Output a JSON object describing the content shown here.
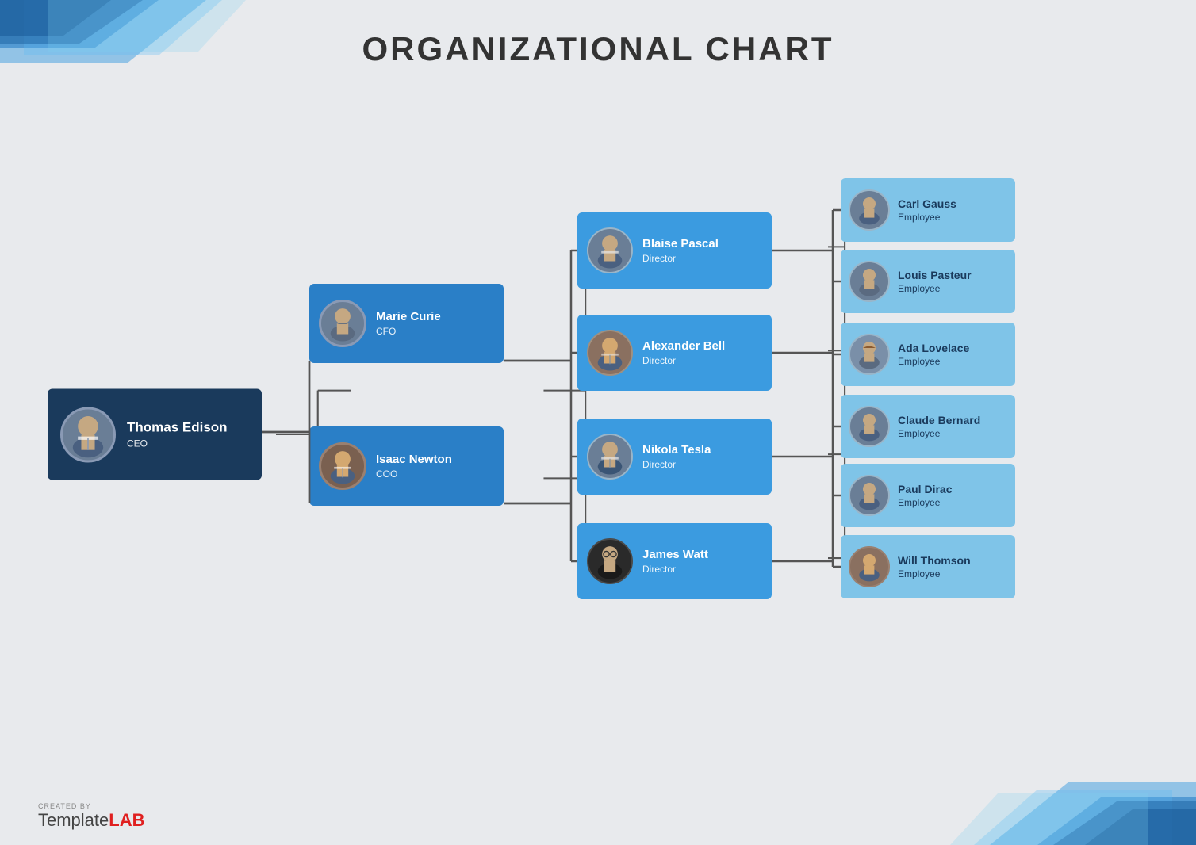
{
  "title": "ORGANIZATIONAL CHART",
  "colors": {
    "ceo_bg": "#1a3a5c",
    "mid_bg": "#2a7fc7",
    "director_bg": "#3b9be0",
    "employee_bg": "#7fc4e8",
    "connector": "#555555",
    "bg": "#e8eaed"
  },
  "nodes": {
    "ceo": {
      "name": "Thomas Edison",
      "role": "CEO"
    },
    "mid": [
      {
        "name": "Marie Curie",
        "role": "CFO",
        "gender": "female"
      },
      {
        "name": "Isaac Newton",
        "role": "COO",
        "gender": "male"
      }
    ],
    "directors": [
      {
        "name": "Blaise Pascal",
        "role": "Director"
      },
      {
        "name": "Alexander Bell",
        "role": "Director"
      },
      {
        "name": "Nikola Tesla",
        "role": "Director"
      },
      {
        "name": "James Watt",
        "role": "Director"
      }
    ],
    "employees": [
      {
        "name": "Carl Gauss",
        "role": "Employee"
      },
      {
        "name": "Louis Pasteur",
        "role": "Employee"
      },
      {
        "name": "Ada Lovelace",
        "role": "Employee",
        "gender": "female"
      },
      {
        "name": "Claude Bernard",
        "role": "Employee"
      },
      {
        "name": "Paul Dirac",
        "role": "Employee"
      },
      {
        "name": "Will Thomson",
        "role": "Employee"
      }
    ]
  },
  "watermark": {
    "created_by": "CREATED BY",
    "brand_template": "Template",
    "brand_lab": "LAB"
  }
}
